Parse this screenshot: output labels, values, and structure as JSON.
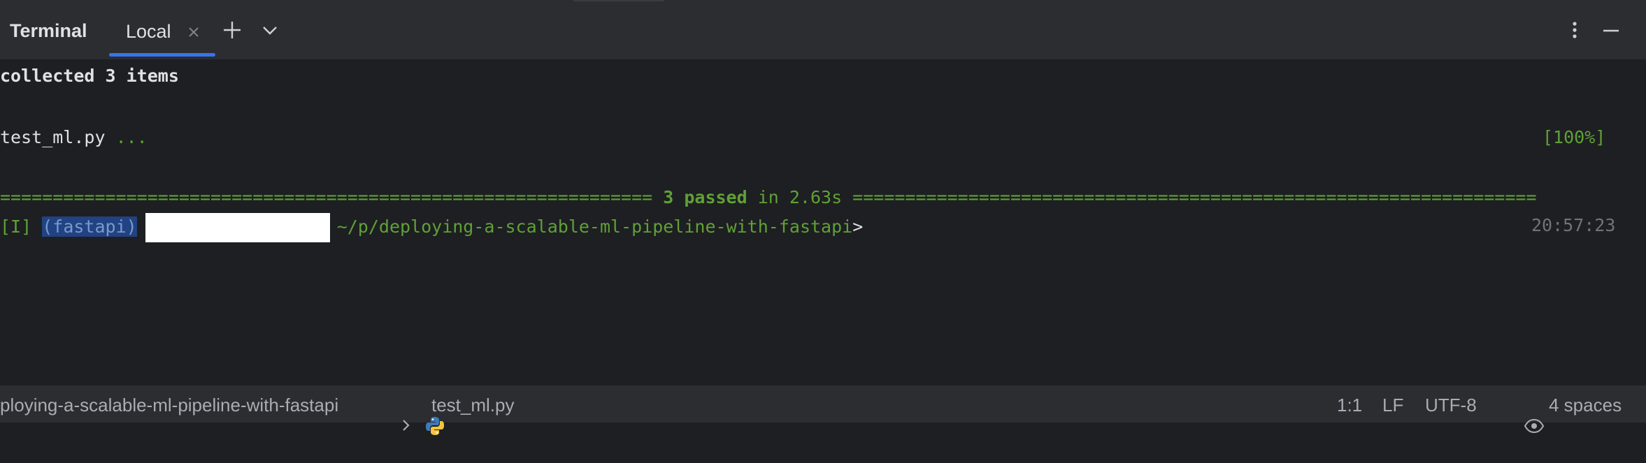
{
  "panel": {
    "title": "Terminal",
    "tabs": [
      {
        "label": "Local",
        "active": true
      }
    ],
    "icons": [
      "close-icon",
      "plus-icon",
      "chevron-down-icon",
      "more-vertical-icon",
      "minimize-icon"
    ]
  },
  "terminal": {
    "line1": "collected 3 items",
    "line2_file": "test_ml.py",
    "line2_dots": "...",
    "line2_progress": "[100%]",
    "line3_left": "============================================================== ",
    "line3_mid": "3 passed",
    "line3_time": " in 2.63s ",
    "line3_right": "=================================================================",
    "prompt_mode": "[I]",
    "prompt_env": "(fastapi)",
    "prompt_path": "~/p/deploying-a-scalable-ml-pipeline-with-fastapi",
    "prompt_char": ">",
    "prompt_time": "20:57:23"
  },
  "statusbar": {
    "breadcrumb_project": "ploying-a-scalable-ml-pipeline-with-fastapi",
    "breadcrumb_file": "test_ml.py",
    "position": "1:1",
    "line_ending": "LF",
    "encoding": "UTF-8",
    "indent": "4 spaces"
  },
  "colors": {
    "background": "#1e1f22",
    "panel": "#2b2d30",
    "accent": "#3574f0",
    "success": "#5fa136",
    "text": "#dfe1e5"
  }
}
